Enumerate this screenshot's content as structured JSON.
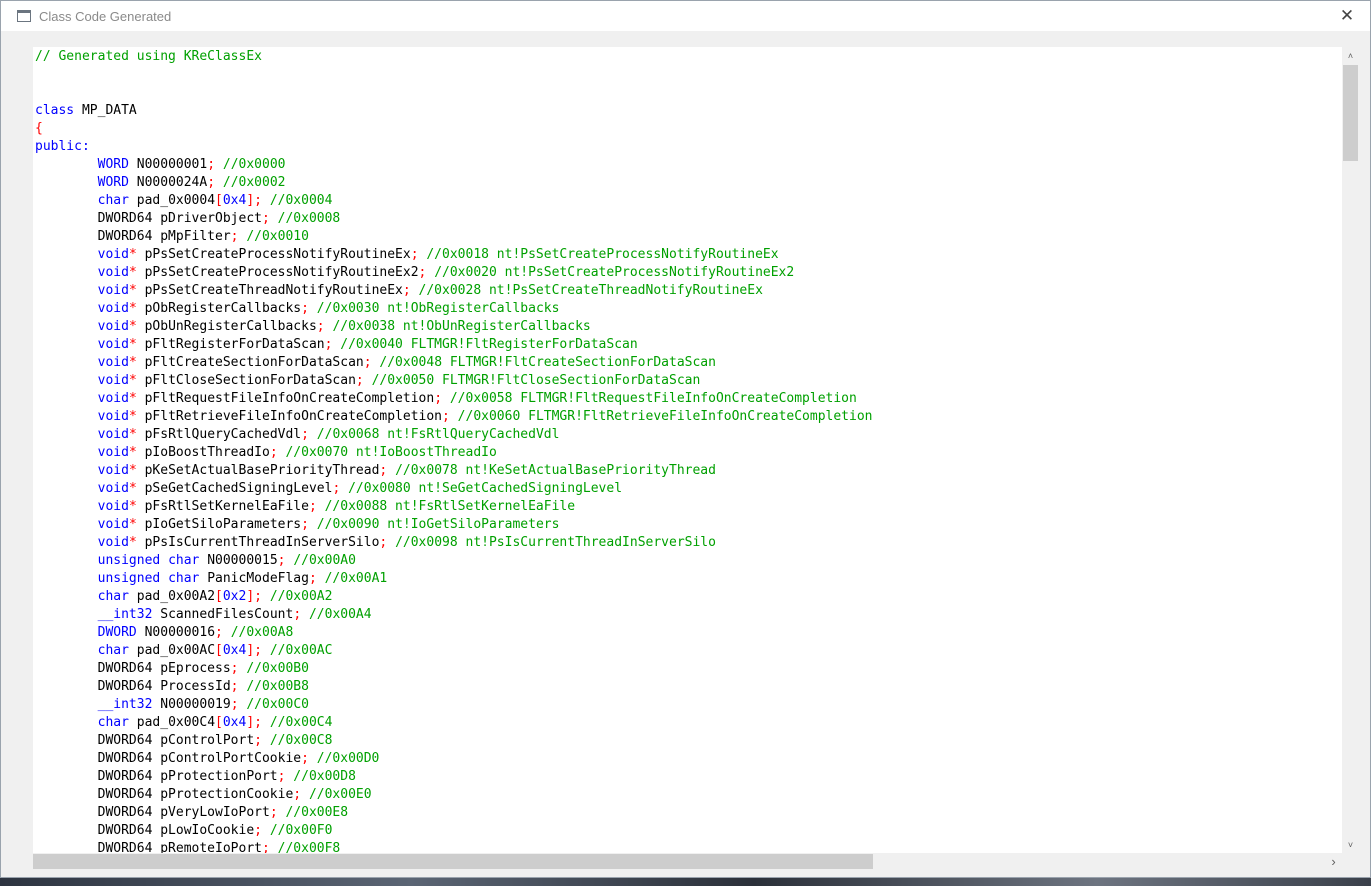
{
  "window": {
    "title": "Class Code Generated",
    "close_glyph": "✕"
  },
  "scrollbars": {
    "up_glyph": "˄",
    "down_glyph": "˅",
    "left_glyph": "‹",
    "right_glyph": "›"
  },
  "colors": {
    "keyword": "#0000ff",
    "bracket": "#ff0000",
    "comment": "#00a000",
    "plain": "#000000"
  },
  "code_lines": [
    [
      [
        "cm",
        "// Generated using KReClassEx"
      ]
    ],
    [],
    [],
    [
      [
        "kw",
        "class"
      ],
      [
        "pl",
        " MP_DATA"
      ]
    ],
    [
      [
        "br",
        "{"
      ]
    ],
    [
      [
        "kw",
        "public:"
      ]
    ],
    [
      [
        "pl",
        "        "
      ],
      [
        "kw",
        "WORD"
      ],
      [
        "pl",
        " N00000001"
      ],
      [
        "br",
        ";"
      ],
      [
        "pl",
        " "
      ],
      [
        "cm",
        "//0x0000"
      ]
    ],
    [
      [
        "pl",
        "        "
      ],
      [
        "kw",
        "WORD"
      ],
      [
        "pl",
        " N0000024A"
      ],
      [
        "br",
        ";"
      ],
      [
        "pl",
        " "
      ],
      [
        "cm",
        "//0x0002"
      ]
    ],
    [
      [
        "pl",
        "        "
      ],
      [
        "kw",
        "char"
      ],
      [
        "pl",
        " pad_0x0004"
      ],
      [
        "br",
        "["
      ],
      [
        "kw",
        "0x4"
      ],
      [
        "br",
        "];"
      ],
      [
        "pl",
        " "
      ],
      [
        "cm",
        "//0x0004"
      ]
    ],
    [
      [
        "pl",
        "        DWORD64 pDriverObject"
      ],
      [
        "br",
        ";"
      ],
      [
        "pl",
        " "
      ],
      [
        "cm",
        "//0x0008"
      ]
    ],
    [
      [
        "pl",
        "        DWORD64 pMpFilter"
      ],
      [
        "br",
        ";"
      ],
      [
        "pl",
        " "
      ],
      [
        "cm",
        "//0x0010"
      ]
    ],
    [
      [
        "pl",
        "        "
      ],
      [
        "kw",
        "void"
      ],
      [
        "br",
        "*"
      ],
      [
        "pl",
        " pPsSetCreateProcessNotifyRoutineEx"
      ],
      [
        "br",
        ";"
      ],
      [
        "pl",
        " "
      ],
      [
        "cm",
        "//0x0018 nt!PsSetCreateProcessNotifyRoutineEx"
      ]
    ],
    [
      [
        "pl",
        "        "
      ],
      [
        "kw",
        "void"
      ],
      [
        "br",
        "*"
      ],
      [
        "pl",
        " pPsSetCreateProcessNotifyRoutineEx2"
      ],
      [
        "br",
        ";"
      ],
      [
        "pl",
        " "
      ],
      [
        "cm",
        "//0x0020 nt!PsSetCreateProcessNotifyRoutineEx2"
      ]
    ],
    [
      [
        "pl",
        "        "
      ],
      [
        "kw",
        "void"
      ],
      [
        "br",
        "*"
      ],
      [
        "pl",
        " pPsSetCreateThreadNotifyRoutineEx"
      ],
      [
        "br",
        ";"
      ],
      [
        "pl",
        " "
      ],
      [
        "cm",
        "//0x0028 nt!PsSetCreateThreadNotifyRoutineEx"
      ]
    ],
    [
      [
        "pl",
        "        "
      ],
      [
        "kw",
        "void"
      ],
      [
        "br",
        "*"
      ],
      [
        "pl",
        " pObRegisterCallbacks"
      ],
      [
        "br",
        ";"
      ],
      [
        "pl",
        " "
      ],
      [
        "cm",
        "//0x0030 nt!ObRegisterCallbacks"
      ]
    ],
    [
      [
        "pl",
        "        "
      ],
      [
        "kw",
        "void"
      ],
      [
        "br",
        "*"
      ],
      [
        "pl",
        " pObUnRegisterCallbacks"
      ],
      [
        "br",
        ";"
      ],
      [
        "pl",
        " "
      ],
      [
        "cm",
        "//0x0038 nt!ObUnRegisterCallbacks"
      ]
    ],
    [
      [
        "pl",
        "        "
      ],
      [
        "kw",
        "void"
      ],
      [
        "br",
        "*"
      ],
      [
        "pl",
        " pFltRegisterForDataScan"
      ],
      [
        "br",
        ";"
      ],
      [
        "pl",
        " "
      ],
      [
        "cm",
        "//0x0040 FLTMGR!FltRegisterForDataScan"
      ]
    ],
    [
      [
        "pl",
        "        "
      ],
      [
        "kw",
        "void"
      ],
      [
        "br",
        "*"
      ],
      [
        "pl",
        " pFltCreateSectionForDataScan"
      ],
      [
        "br",
        ";"
      ],
      [
        "pl",
        " "
      ],
      [
        "cm",
        "//0x0048 FLTMGR!FltCreateSectionForDataScan"
      ]
    ],
    [
      [
        "pl",
        "        "
      ],
      [
        "kw",
        "void"
      ],
      [
        "br",
        "*"
      ],
      [
        "pl",
        " pFltCloseSectionForDataScan"
      ],
      [
        "br",
        ";"
      ],
      [
        "pl",
        " "
      ],
      [
        "cm",
        "//0x0050 FLTMGR!FltCloseSectionForDataScan"
      ]
    ],
    [
      [
        "pl",
        "        "
      ],
      [
        "kw",
        "void"
      ],
      [
        "br",
        "*"
      ],
      [
        "pl",
        " pFltRequestFileInfoOnCreateCompletion"
      ],
      [
        "br",
        ";"
      ],
      [
        "pl",
        " "
      ],
      [
        "cm",
        "//0x0058 FLTMGR!FltRequestFileInfoOnCreateCompletion"
      ]
    ],
    [
      [
        "pl",
        "        "
      ],
      [
        "kw",
        "void"
      ],
      [
        "br",
        "*"
      ],
      [
        "pl",
        " pFltRetrieveFileInfoOnCreateCompletion"
      ],
      [
        "br",
        ";"
      ],
      [
        "pl",
        " "
      ],
      [
        "cm",
        "//0x0060 FLTMGR!FltRetrieveFileInfoOnCreateCompletion"
      ]
    ],
    [
      [
        "pl",
        "        "
      ],
      [
        "kw",
        "void"
      ],
      [
        "br",
        "*"
      ],
      [
        "pl",
        " pFsRtlQueryCachedVdl"
      ],
      [
        "br",
        ";"
      ],
      [
        "pl",
        " "
      ],
      [
        "cm",
        "//0x0068 nt!FsRtlQueryCachedVdl"
      ]
    ],
    [
      [
        "pl",
        "        "
      ],
      [
        "kw",
        "void"
      ],
      [
        "br",
        "*"
      ],
      [
        "pl",
        " pIoBoostThreadIo"
      ],
      [
        "br",
        ";"
      ],
      [
        "pl",
        " "
      ],
      [
        "cm",
        "//0x0070 nt!IoBoostThreadIo"
      ]
    ],
    [
      [
        "pl",
        "        "
      ],
      [
        "kw",
        "void"
      ],
      [
        "br",
        "*"
      ],
      [
        "pl",
        " pKeSetActualBasePriorityThread"
      ],
      [
        "br",
        ";"
      ],
      [
        "pl",
        " "
      ],
      [
        "cm",
        "//0x0078 nt!KeSetActualBasePriorityThread"
      ]
    ],
    [
      [
        "pl",
        "        "
      ],
      [
        "kw",
        "void"
      ],
      [
        "br",
        "*"
      ],
      [
        "pl",
        " pSeGetCachedSigningLevel"
      ],
      [
        "br",
        ";"
      ],
      [
        "pl",
        " "
      ],
      [
        "cm",
        "//0x0080 nt!SeGetCachedSigningLevel"
      ]
    ],
    [
      [
        "pl",
        "        "
      ],
      [
        "kw",
        "void"
      ],
      [
        "br",
        "*"
      ],
      [
        "pl",
        " pFsRtlSetKernelEaFile"
      ],
      [
        "br",
        ";"
      ],
      [
        "pl",
        " "
      ],
      [
        "cm",
        "//0x0088 nt!FsRtlSetKernelEaFile"
      ]
    ],
    [
      [
        "pl",
        "        "
      ],
      [
        "kw",
        "void"
      ],
      [
        "br",
        "*"
      ],
      [
        "pl",
        " pIoGetSiloParameters"
      ],
      [
        "br",
        ";"
      ],
      [
        "pl",
        " "
      ],
      [
        "cm",
        "//0x0090 nt!IoGetSiloParameters"
      ]
    ],
    [
      [
        "pl",
        "        "
      ],
      [
        "kw",
        "void"
      ],
      [
        "br",
        "*"
      ],
      [
        "pl",
        " pPsIsCurrentThreadInServerSilo"
      ],
      [
        "br",
        ";"
      ],
      [
        "pl",
        " "
      ],
      [
        "cm",
        "//0x0098 nt!PsIsCurrentThreadInServerSilo"
      ]
    ],
    [
      [
        "pl",
        "        "
      ],
      [
        "kw",
        "unsigned char"
      ],
      [
        "pl",
        " N00000015"
      ],
      [
        "br",
        ";"
      ],
      [
        "pl",
        " "
      ],
      [
        "cm",
        "//0x00A0"
      ]
    ],
    [
      [
        "pl",
        "        "
      ],
      [
        "kw",
        "unsigned char"
      ],
      [
        "pl",
        " PanicModeFlag"
      ],
      [
        "br",
        ";"
      ],
      [
        "pl",
        " "
      ],
      [
        "cm",
        "//0x00A1"
      ]
    ],
    [
      [
        "pl",
        "        "
      ],
      [
        "kw",
        "char"
      ],
      [
        "pl",
        " pad_0x00A2"
      ],
      [
        "br",
        "["
      ],
      [
        "kw",
        "0x2"
      ],
      [
        "br",
        "];"
      ],
      [
        "pl",
        " "
      ],
      [
        "cm",
        "//0x00A2"
      ]
    ],
    [
      [
        "pl",
        "        "
      ],
      [
        "kw",
        "__int32"
      ],
      [
        "pl",
        " ScannedFilesCount"
      ],
      [
        "br",
        ";"
      ],
      [
        "pl",
        " "
      ],
      [
        "cm",
        "//0x00A4"
      ]
    ],
    [
      [
        "pl",
        "        "
      ],
      [
        "kw",
        "DWORD"
      ],
      [
        "pl",
        " N00000016"
      ],
      [
        "br",
        ";"
      ],
      [
        "pl",
        " "
      ],
      [
        "cm",
        "//0x00A8"
      ]
    ],
    [
      [
        "pl",
        "        "
      ],
      [
        "kw",
        "char"
      ],
      [
        "pl",
        " pad_0x00AC"
      ],
      [
        "br",
        "["
      ],
      [
        "kw",
        "0x4"
      ],
      [
        "br",
        "];"
      ],
      [
        "pl",
        " "
      ],
      [
        "cm",
        "//0x00AC"
      ]
    ],
    [
      [
        "pl",
        "        DWORD64 pEprocess"
      ],
      [
        "br",
        ";"
      ],
      [
        "pl",
        " "
      ],
      [
        "cm",
        "//0x00B0"
      ]
    ],
    [
      [
        "pl",
        "        DWORD64 ProcessId"
      ],
      [
        "br",
        ";"
      ],
      [
        "pl",
        " "
      ],
      [
        "cm",
        "//0x00B8"
      ]
    ],
    [
      [
        "pl",
        "        "
      ],
      [
        "kw",
        "__int32"
      ],
      [
        "pl",
        " N00000019"
      ],
      [
        "br",
        ";"
      ],
      [
        "pl",
        " "
      ],
      [
        "cm",
        "//0x00C0"
      ]
    ],
    [
      [
        "pl",
        "        "
      ],
      [
        "kw",
        "char"
      ],
      [
        "pl",
        " pad_0x00C4"
      ],
      [
        "br",
        "["
      ],
      [
        "kw",
        "0x4"
      ],
      [
        "br",
        "];"
      ],
      [
        "pl",
        " "
      ],
      [
        "cm",
        "//0x00C4"
      ]
    ],
    [
      [
        "pl",
        "        DWORD64 pControlPort"
      ],
      [
        "br",
        ";"
      ],
      [
        "pl",
        " "
      ],
      [
        "cm",
        "//0x00C8"
      ]
    ],
    [
      [
        "pl",
        "        DWORD64 pControlPortCookie"
      ],
      [
        "br",
        ";"
      ],
      [
        "pl",
        " "
      ],
      [
        "cm",
        "//0x00D0"
      ]
    ],
    [
      [
        "pl",
        "        DWORD64 pProtectionPort"
      ],
      [
        "br",
        ";"
      ],
      [
        "pl",
        " "
      ],
      [
        "cm",
        "//0x00D8"
      ]
    ],
    [
      [
        "pl",
        "        DWORD64 pProtectionCookie"
      ],
      [
        "br",
        ";"
      ],
      [
        "pl",
        " "
      ],
      [
        "cm",
        "//0x00E0"
      ]
    ],
    [
      [
        "pl",
        "        DWORD64 pVeryLowIoPort"
      ],
      [
        "br",
        ";"
      ],
      [
        "pl",
        " "
      ],
      [
        "cm",
        "//0x00E8"
      ]
    ],
    [
      [
        "pl",
        "        DWORD64 pLowIoCookie"
      ],
      [
        "br",
        ";"
      ],
      [
        "pl",
        " "
      ],
      [
        "cm",
        "//0x00F0"
      ]
    ],
    [
      [
        "pl",
        "        DWORD64 pRemoteIoPort"
      ],
      [
        "br",
        ";"
      ],
      [
        "pl",
        " "
      ],
      [
        "cm",
        "//0x00F8"
      ]
    ]
  ]
}
